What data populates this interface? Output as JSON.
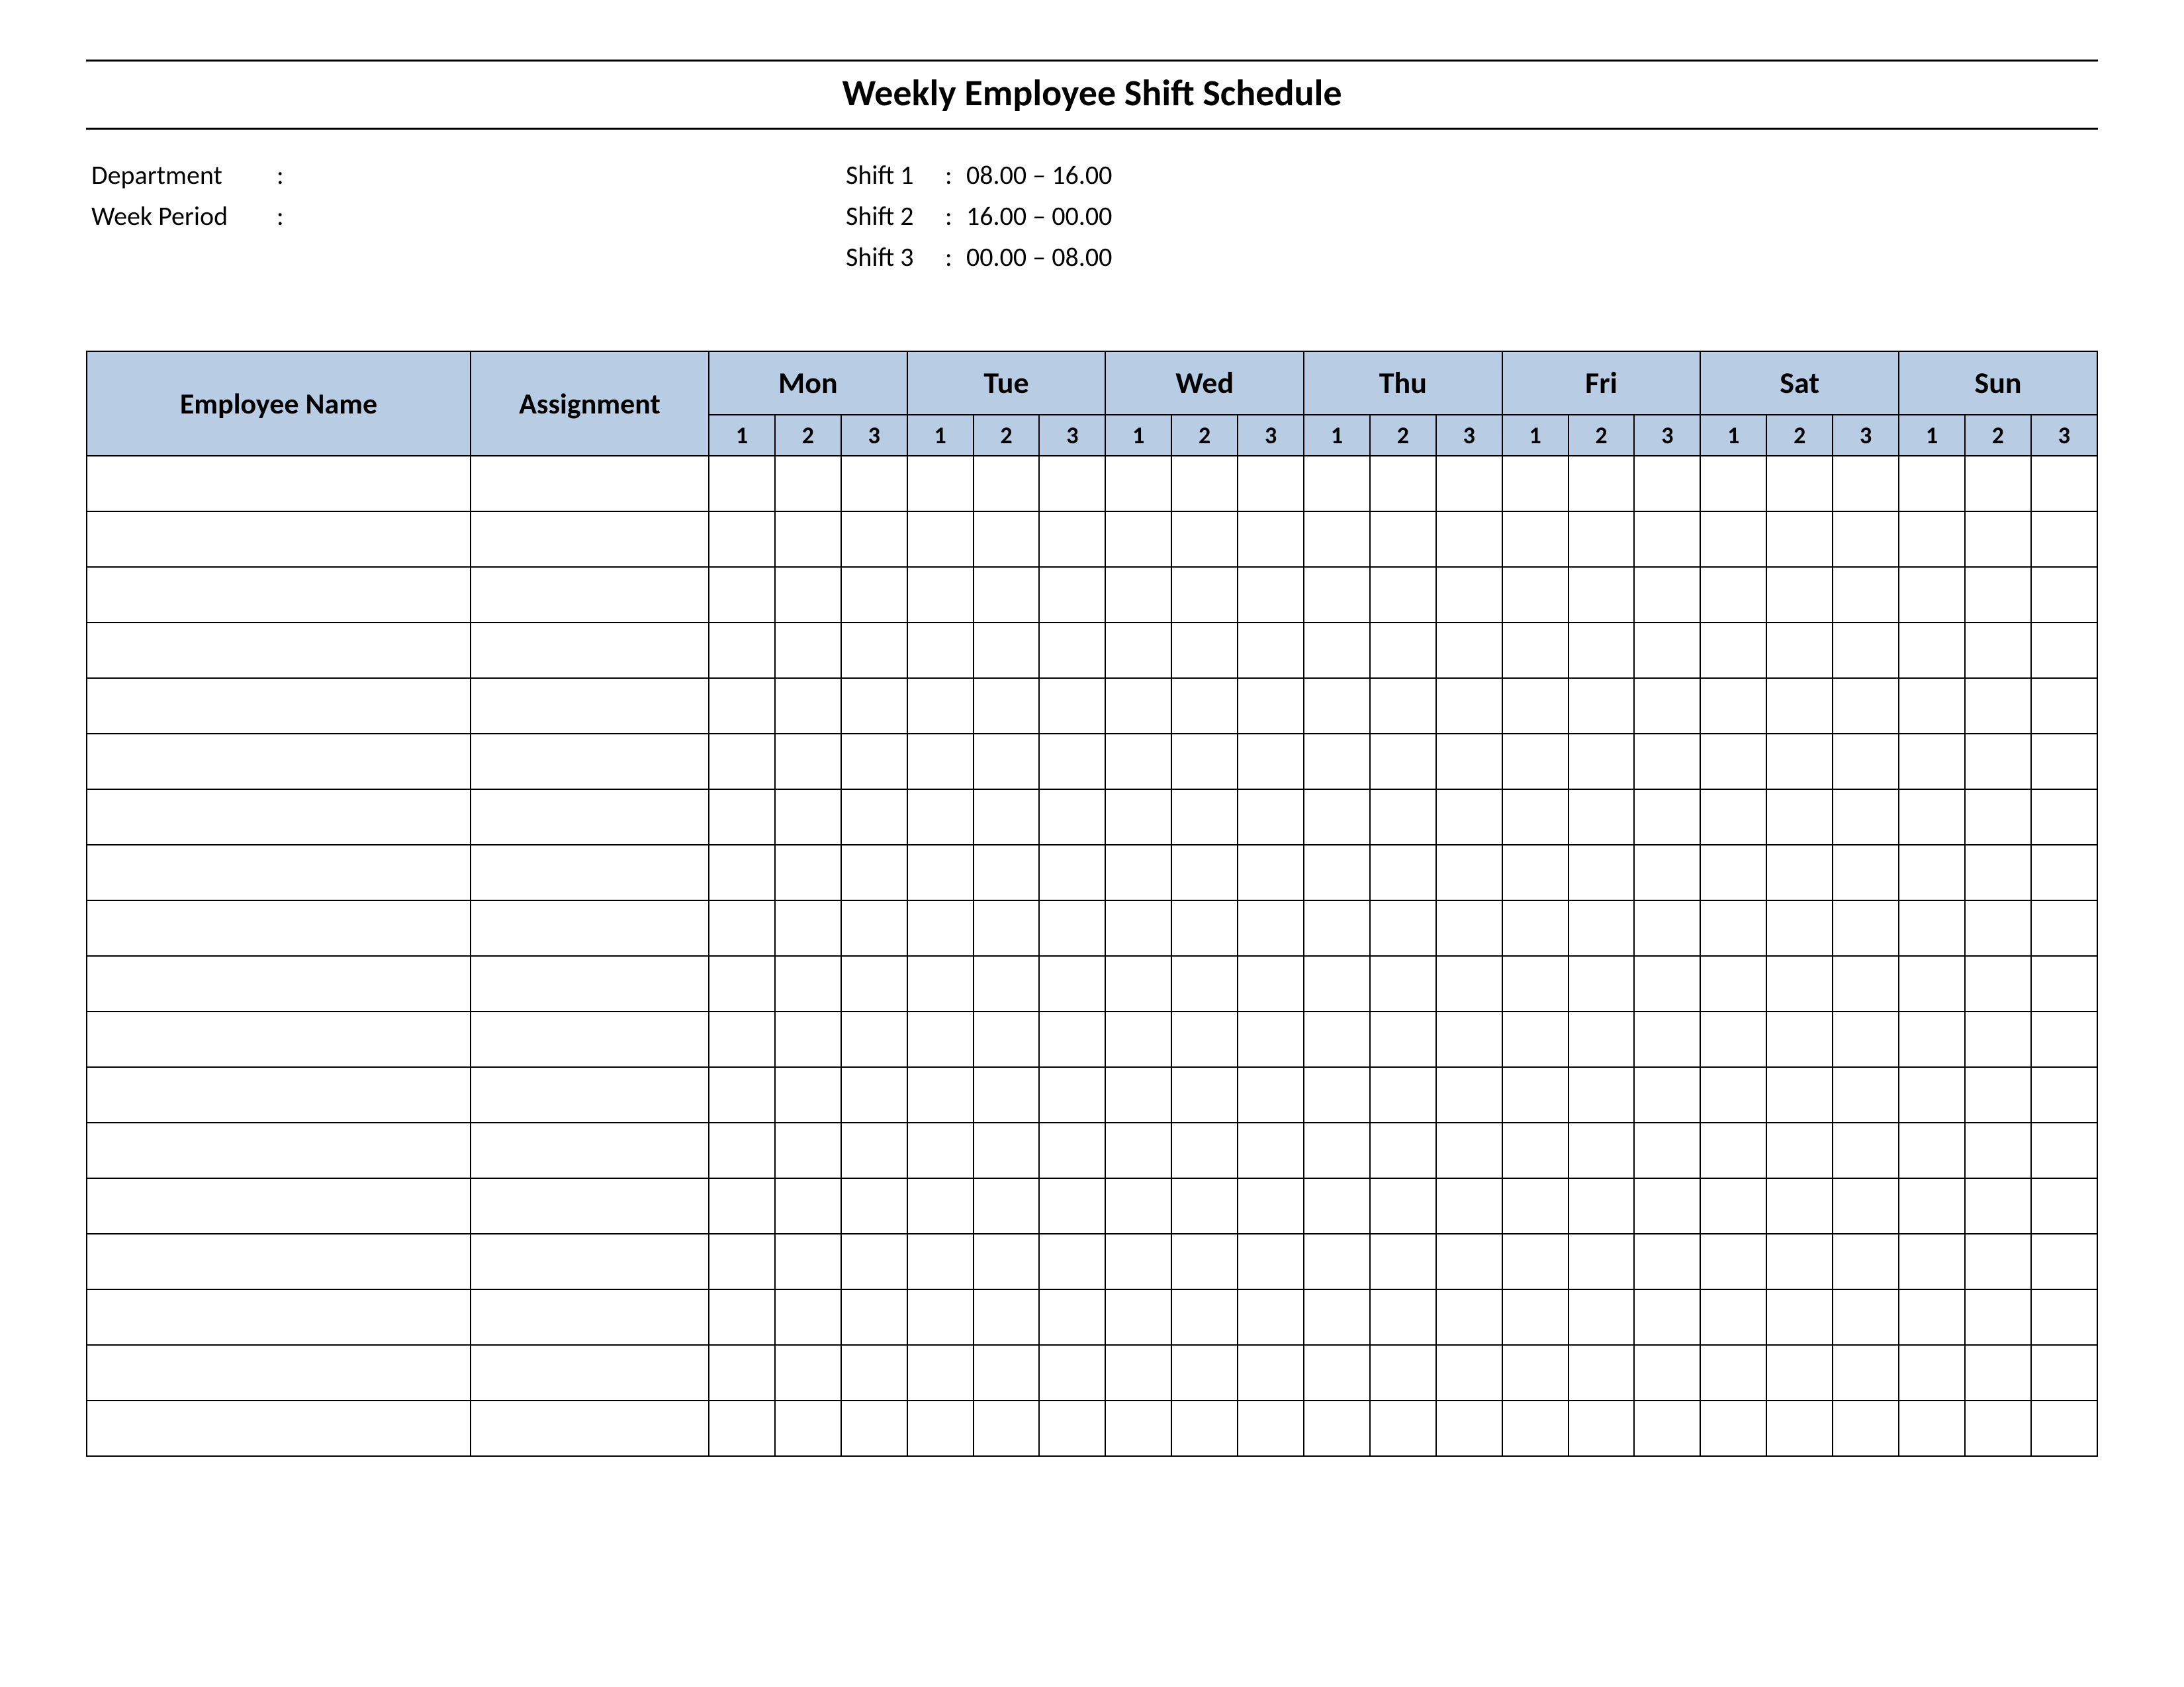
{
  "title": "Weekly Employee Shift Schedule",
  "meta": {
    "department_label": "Department",
    "department_value": "",
    "week_period_label": "Week  Period",
    "week_period_value": "",
    "shifts": [
      {
        "label": "Shift 1",
        "times": "08.00  – 16.00"
      },
      {
        "label": "Shift 2",
        "times": "16.00  – 00.00"
      },
      {
        "label": "Shift 3",
        "times": "00.00  – 08.00"
      }
    ]
  },
  "table": {
    "employee_header": "Employee Name",
    "assignment_header": "Assignment",
    "days": [
      "Mon",
      "Tue",
      "Wed",
      "Thu",
      "Fri",
      "Sat",
      "Sun"
    ],
    "shift_labels": [
      "1",
      "2",
      "3"
    ],
    "row_count": 18
  }
}
